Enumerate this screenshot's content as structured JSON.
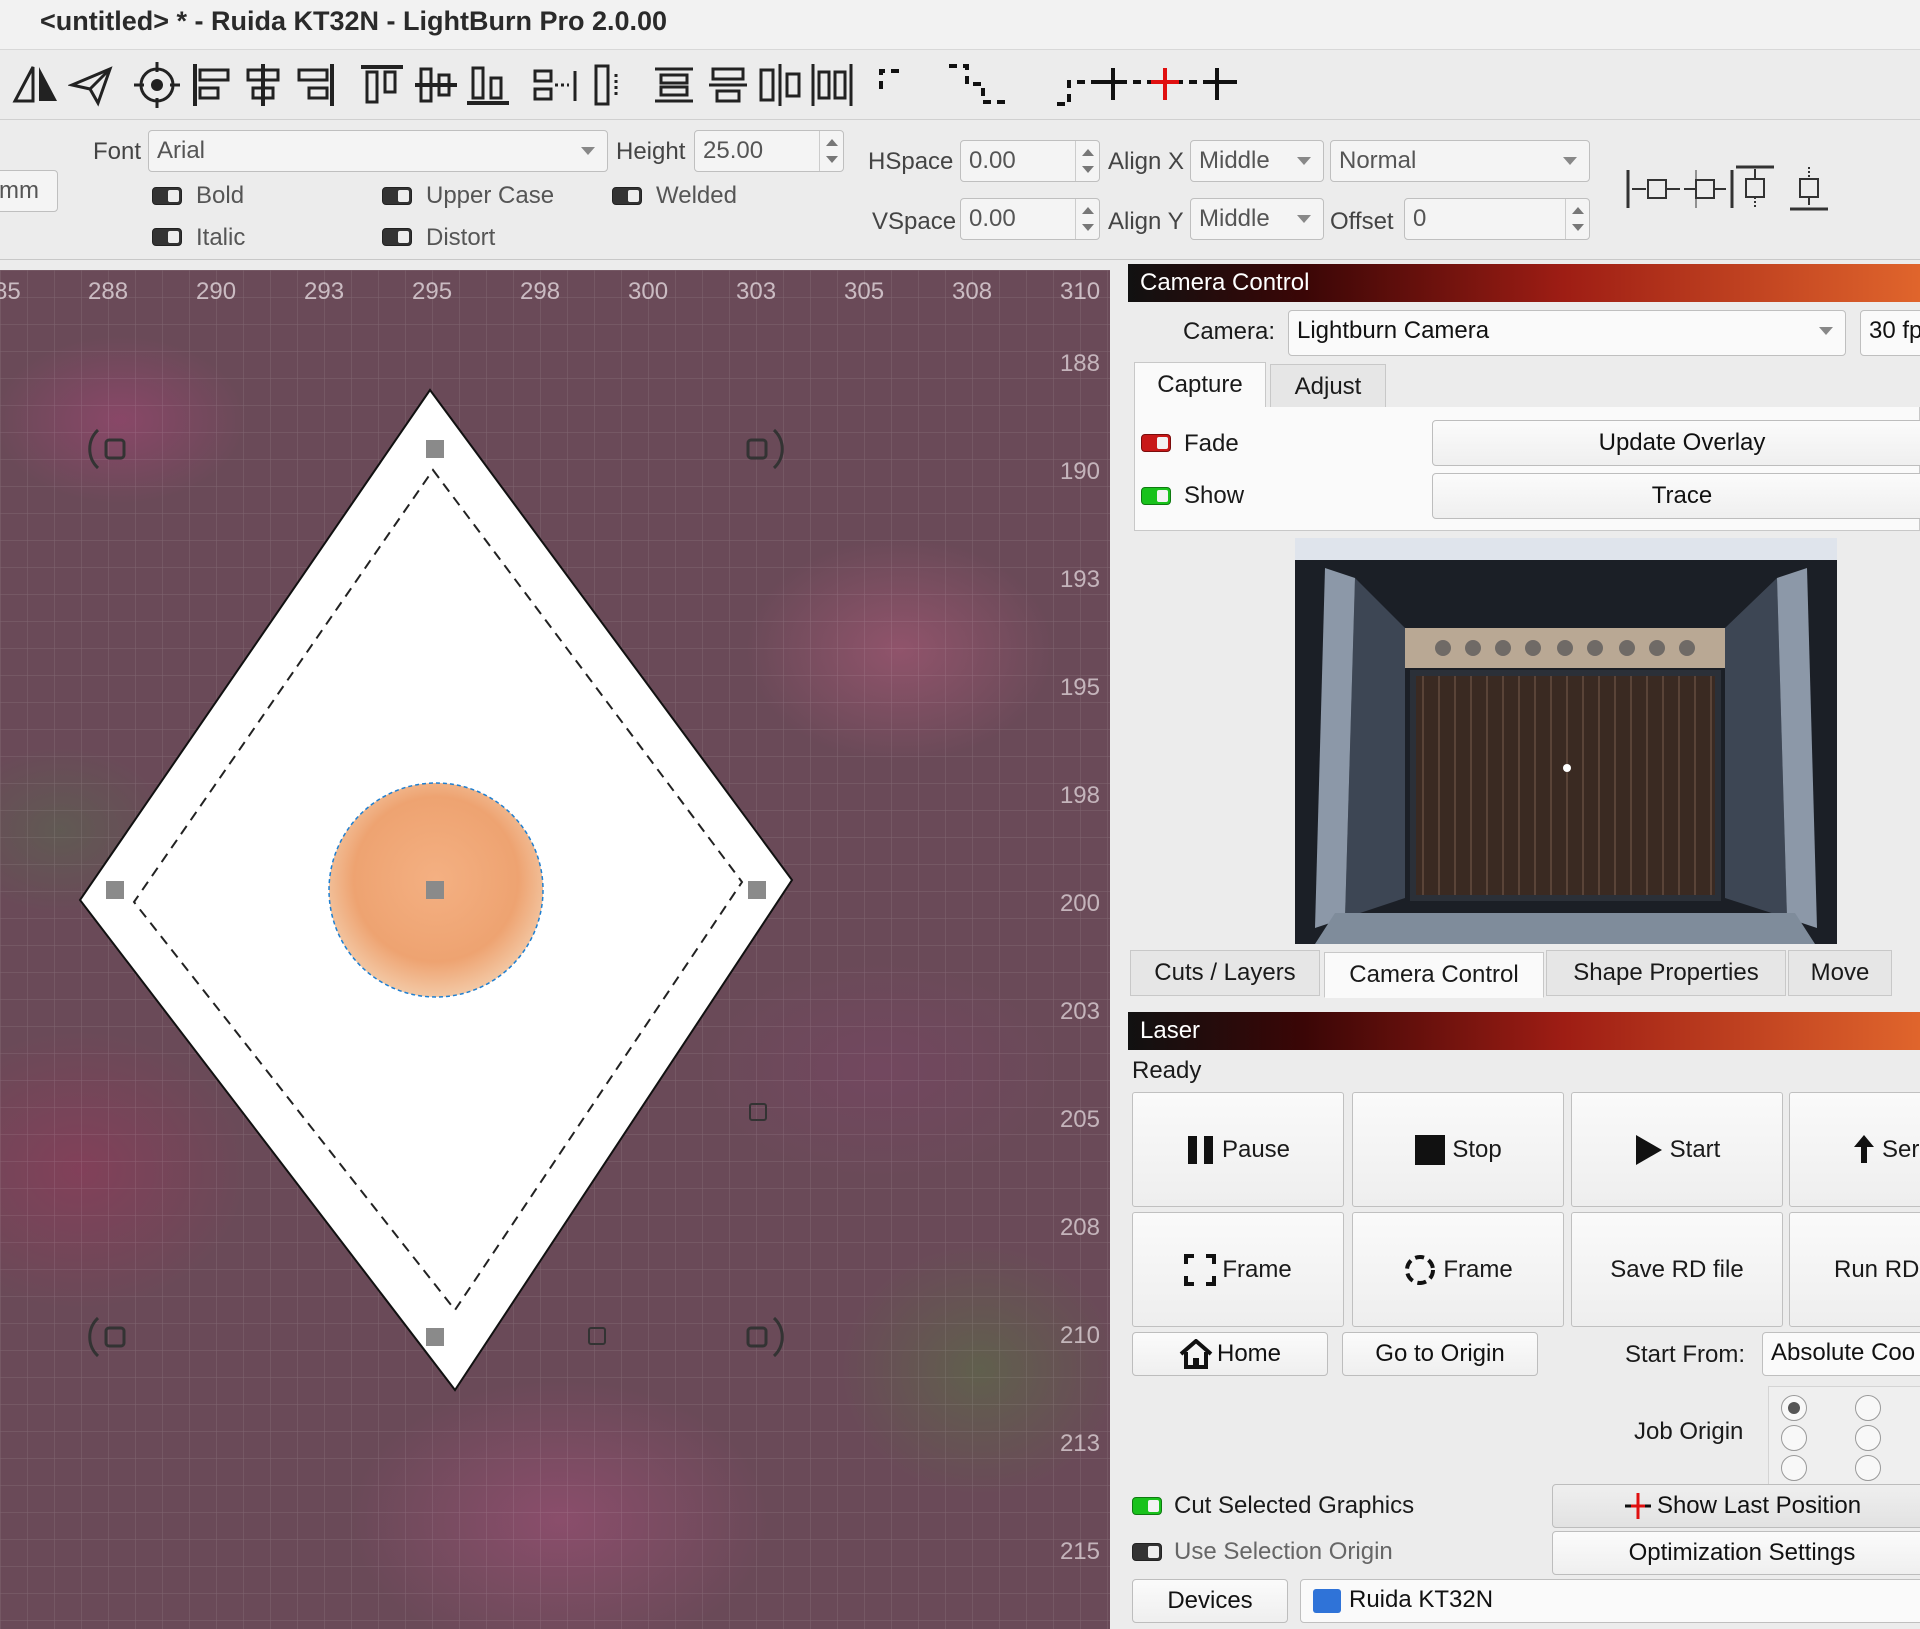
{
  "window": {
    "title": "<untitled> * - Ruida KT32N - LightBurn Pro 2.0.00"
  },
  "text_bar": {
    "unit": "mm",
    "font_label": "Font",
    "font_value": "Arial",
    "height_label": "Height",
    "height_value": "25.00",
    "hspace_label": "HSpace",
    "hspace_value": "0.00",
    "vspace_label": "VSpace",
    "vspace_value": "0.00",
    "alignx_label": "Align X",
    "alignx_value": "Middle",
    "aligny_label": "Align Y",
    "aligny_value": "Middle",
    "mode_value": "Normal",
    "offset_label": "Offset",
    "offset_value": "0",
    "bold": "Bold",
    "italic": "Italic",
    "upper_case": "Upper Case",
    "distort": "Distort",
    "welded": "Welded"
  },
  "rulers": {
    "top": [
      "85",
      "288",
      "290",
      "293",
      "295",
      "298",
      "300",
      "303",
      "305",
      "308",
      "310"
    ],
    "side": [
      "188",
      "190",
      "193",
      "195",
      "198",
      "200",
      "203",
      "205",
      "208",
      "210",
      "213",
      "215"
    ]
  },
  "camera_control": {
    "title": "Camera Control",
    "camera_label": "Camera:",
    "camera_value": "Lightburn Camera",
    "fps_value": "30 fp",
    "tabs": [
      "Capture",
      "Adjust"
    ],
    "fade_label": "Fade",
    "show_label": "Show",
    "update_overlay": "Update Overlay",
    "trace": "Trace"
  },
  "dock_tabs": [
    "Cuts / Layers",
    "Camera Control",
    "Shape Properties",
    "Move"
  ],
  "laser": {
    "title": "Laser",
    "status": "Ready",
    "buttons": {
      "pause": "Pause",
      "stop": "Stop",
      "start": "Start",
      "send": "Ser",
      "frame": "Frame",
      "frame_circle": "Frame",
      "save_rd": "Save RD file",
      "run_rd": "Run RD",
      "home": "Home",
      "go_origin": "Go to Origin"
    },
    "start_from_label": "Start From:",
    "start_from_value": "Absolute Coo",
    "job_origin_label": "Job Origin",
    "cut_selected": "Cut Selected Graphics",
    "use_selection_origin": "Use Selection Origin",
    "show_last_position": "Show Last Position",
    "optimization_settings": "Optimization Settings",
    "devices": "Devices",
    "device_value": "Ruida KT32N"
  }
}
